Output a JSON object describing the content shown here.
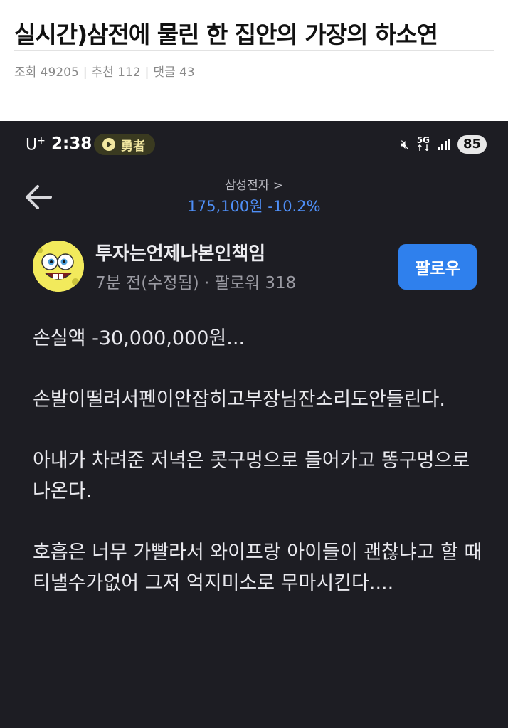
{
  "article": {
    "title": "실시간)삼전에 물린 한 집안의 가장의 하소연",
    "views": "조회 49205",
    "likes": "추천 112",
    "comments": "댓글 43"
  },
  "statusbar": {
    "carrier": "U",
    "carrier_sup": "+",
    "time": "2:38",
    "app_badge": "勇者",
    "network": "5G",
    "battery": "85"
  },
  "stock": {
    "name": "삼성전자 >",
    "price": "175,100원 -10.2%"
  },
  "author": {
    "name": "투자는언제나본인책임",
    "meta": "7분 전(수정됨) · 팔로워 318",
    "follow_label": "팔로우"
  },
  "post": {
    "paragraphs": [
      "손실액 -30,000,000원...",
      "손발이떨려서펜이안잡히고부장님잔소리도안들린다.",
      "아내가 차려준 저녁은 콧구멍으로 들어가고 똥구멍으로나온다.",
      "호흡은 너무 가빨라서 와이프랑 아이들이 괜찮냐고 할 때 티낼수가없어 그저 억지미소로 무마시킨다...."
    ]
  },
  "colors": {
    "phone_bg": "#1d1d23",
    "accent_blue": "#2f80ed",
    "price_blue": "#4f8ff7"
  }
}
